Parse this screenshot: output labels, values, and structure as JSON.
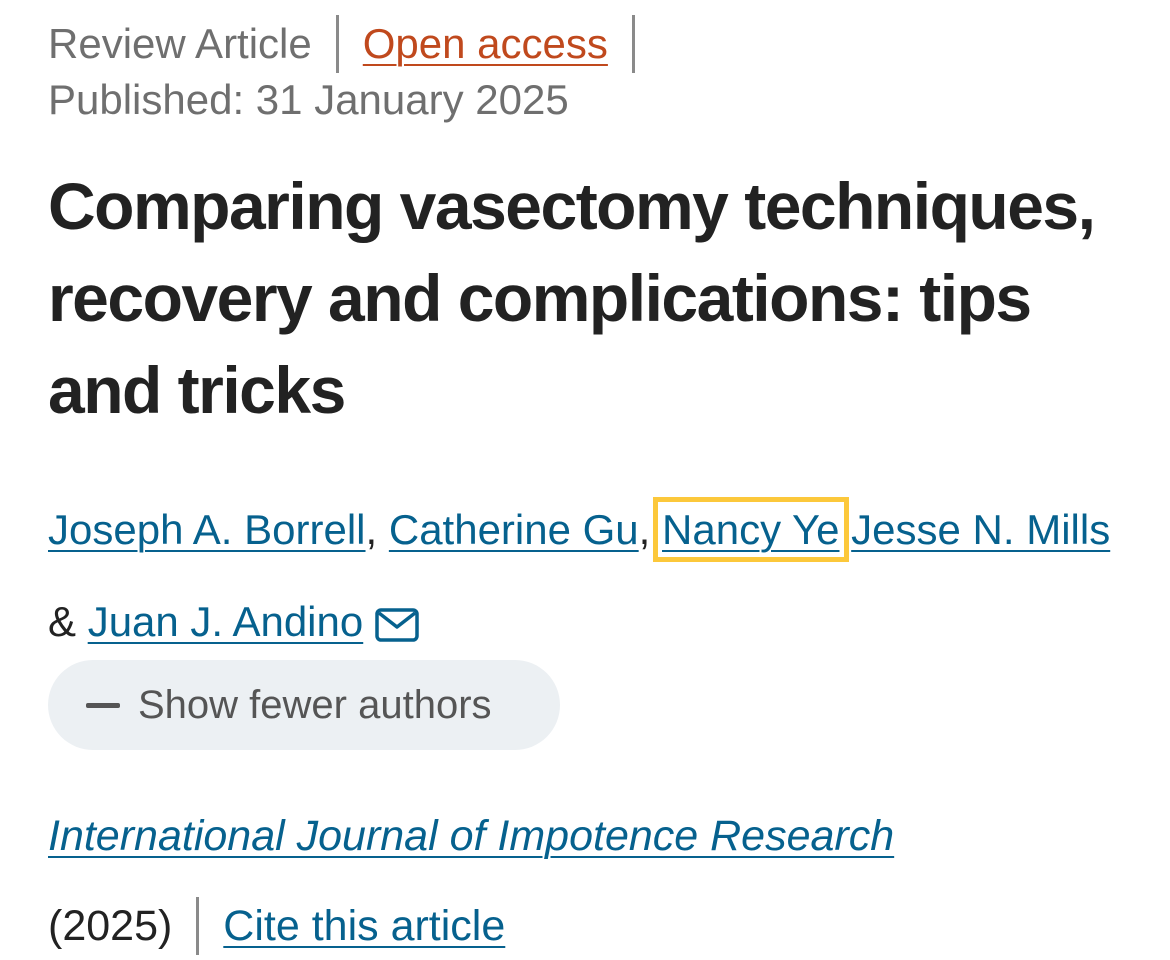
{
  "meta": {
    "article_type": "Review Article",
    "access_label": "Open access",
    "published": "Published: 31 January 2025"
  },
  "article": {
    "title": "Comparing vasectomy techniques, recovery and complications: tips and tricks"
  },
  "authors": {
    "list": [
      {
        "name": "Joseph A. Borrell"
      },
      {
        "name": "Catherine Gu"
      },
      {
        "name": "Nancy Ye"
      },
      {
        "name": "Jesse N. Mills"
      },
      {
        "name": "Juan J. Andino"
      }
    ],
    "separator_comma": ",",
    "separator_and": "&",
    "toggle_label": "Show fewer authors",
    "contact_icon": "mail-icon"
  },
  "journal": {
    "name": "International Journal of Impotence Research",
    "year": "(2025)",
    "cite_label": "Cite this article"
  },
  "colors": {
    "link": "#06618e",
    "open_access": "#c0491d",
    "highlight": "#fcc83b",
    "button_bg": "#ecf0f3"
  }
}
